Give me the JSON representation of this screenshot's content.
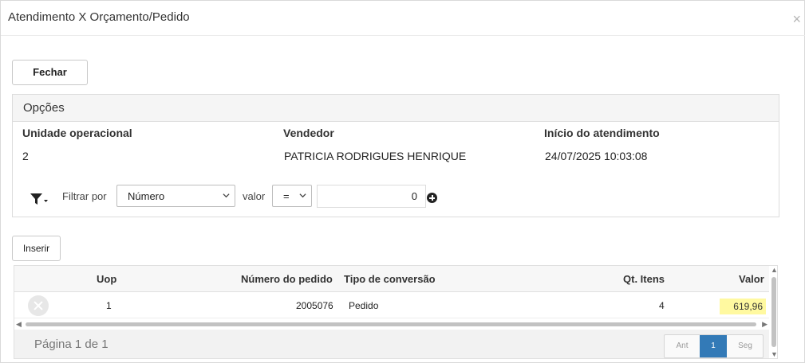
{
  "modal": {
    "title": "Atendimento X Orçamento/Pedido",
    "close_symbol": "×"
  },
  "toolbar": {
    "fechar_label": "Fechar",
    "inserir_label": "Inserir"
  },
  "options": {
    "title": "Opções",
    "unidade_label": "Unidade operacional",
    "unidade_value": "2",
    "vendedor_label": "Vendedor",
    "vendedor_value": "PATRICIA RODRIGUES HENRIQUE",
    "inicio_label": "Início do atendimento",
    "inicio_value": "24/07/2025 10:03:08"
  },
  "filter": {
    "filtrar_label": "Filtrar por",
    "field_selected": "Número",
    "valor_label": "valor",
    "operator_selected": "=",
    "value": "0"
  },
  "grid": {
    "columns": {
      "uop": "Uop",
      "numero": "Número do pedido",
      "tipo": "Tipo de conversão",
      "qt": "Qt. Itens",
      "valor": "Valor"
    },
    "rows": [
      {
        "uop": "1",
        "numero": "2005076",
        "tipo": "Pedido",
        "qt": "4",
        "valor": "619,96"
      }
    ],
    "highlight_color": "#fff9a0"
  },
  "pagination": {
    "info": "Página 1 de 1",
    "prev_label": "Ant",
    "current": "1",
    "next_label": "Seg"
  },
  "colors": {
    "accent": "#337ab7"
  }
}
